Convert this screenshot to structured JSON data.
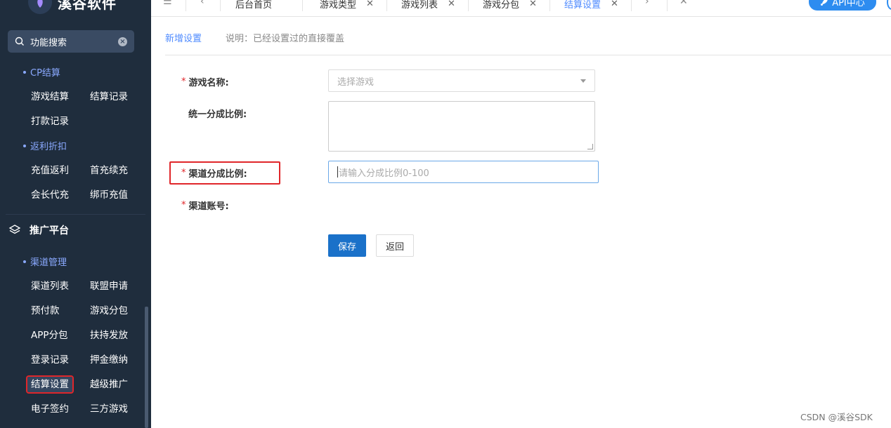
{
  "sidebar": {
    "brand": "溪谷软件",
    "search_placeholder": "功能搜索",
    "groups": [
      {
        "title": "CP结算",
        "items": [
          "游戏结算",
          "结算记录",
          "打款记录"
        ]
      },
      {
        "title": "返利折扣",
        "items": [
          "充值返利",
          "首充续充",
          "会长代充",
          "绑币充值"
        ]
      }
    ],
    "section_title": "推广平台",
    "channel_group": {
      "title": "渠道管理",
      "items": [
        "渠道列表",
        "联盟申请",
        "预付款",
        "游戏分包",
        "APP分包",
        "扶持发放",
        "登录记录",
        "押金缴纳",
        "结算设置",
        "越级推广",
        "电子签约",
        "三方游戏"
      ]
    }
  },
  "tabs": {
    "items": [
      {
        "label": "后台首页",
        "closable": false
      },
      {
        "label": "游戏类型",
        "closable": true
      },
      {
        "label": "游戏列表",
        "closable": true
      },
      {
        "label": "游戏分包",
        "closable": true
      },
      {
        "label": "结算设置",
        "closable": true,
        "active": true
      }
    ],
    "api_button": "API中心"
  },
  "page": {
    "subtab_active": "新增设置",
    "subtab_note": "说明：已经设置过的直接覆盖"
  },
  "form": {
    "game_name_label": "游戏名称:",
    "game_select_placeholder": "选择游戏",
    "unified_ratio_label": "统一分成比例:",
    "channel_ratio_label": "渠道分成比例:",
    "channel_ratio_placeholder": "请输入分成比例0-100",
    "channel_account_label": "渠道账号:",
    "save_button": "保存",
    "back_button": "返回"
  },
  "watermark": "CSDN @溪谷SDK",
  "colors": {
    "sidebar_bg": "#1f2d3d",
    "accent": "#4f8bff",
    "primary_button": "#1a71c9",
    "highlight": "#e0262a"
  }
}
